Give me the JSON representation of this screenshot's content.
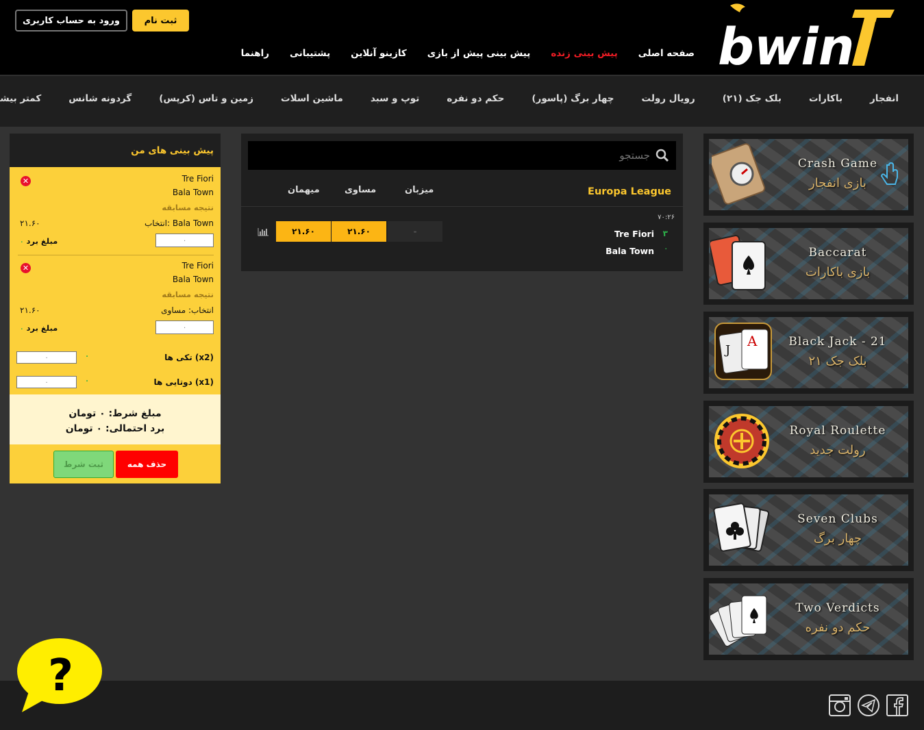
{
  "header": {
    "logo_text": "bwin",
    "login_label": "ورود به حساب کاربری",
    "register_label": "ثبت نام",
    "nav": [
      "صفحه اصلی",
      "پیش بینی زنده",
      "پیش بینی پیش از بازی",
      "کازینو آنلاین",
      "پشتیبانی",
      "راهنما"
    ],
    "active_nav": "پیش بینی زنده"
  },
  "game_nav": [
    "انفجار",
    "باکارات",
    "بلک جک (۲۱)",
    "رویال رولت",
    "چهار برگ (پاسور)",
    "حکم دو نفره",
    "توپ و سبد",
    "ماشین اسلات",
    "زمین و تاس (کرپس)",
    "گردونه شانس",
    "کمتر بیشتر"
  ],
  "banners": [
    {
      "en": "Crash Game",
      "fa": "بازی انفجار"
    },
    {
      "en": "Baccarat",
      "fa": "بازی باکارات"
    },
    {
      "en": "Black Jack - 21",
      "fa": "بلک جک ۲۱"
    },
    {
      "en": "Royal Roulette",
      "fa": "رولت جدید"
    },
    {
      "en": "Seven Clubs",
      "fa": "چهار برگ"
    },
    {
      "en": "Two Verdicts",
      "fa": "حکم دو نفره"
    }
  ],
  "center": {
    "search_placeholder": "جستجو",
    "league": "Europa League",
    "col_home": "میزبان",
    "col_draw": "مساوی",
    "col_away": "میهمان",
    "match": {
      "time": "۷۰:۲۶",
      "home": "Tre Fiori",
      "away": "Bala Town",
      "home_score": "۳",
      "away_score": "۰",
      "odds_home": "-",
      "odds_draw": "۲۱.۶۰",
      "odds_away": "۲۱.۶۰"
    }
  },
  "slip": {
    "title": "پیش بینی های من",
    "bets": [
      {
        "home": "Tre Fiori",
        "away": "Bala Town",
        "market": "نتیجه مسابقه",
        "selection": "انتخاب: Bala Town",
        "odds": "۲۱.۶۰",
        "amount_label": "مبلغ برد",
        "amount": "۰",
        "stake": "۰"
      },
      {
        "home": "Tre Fiori",
        "away": "Bala Town",
        "market": "نتیجه مسابقه",
        "selection": "انتخاب: مساوی",
        "odds": "۲۱.۶۰",
        "amount_label": "مبلغ برد",
        "amount": "۰",
        "stake": "۰"
      }
    ],
    "singles_label": "تکی ها (x2)",
    "doubles_label": "دوتایی ها (x1)",
    "singles_value": "۰",
    "doubles_value": "۰",
    "singles_stake": "۰",
    "doubles_stake": "۰",
    "total_stake": "مبلغ شرط: ۰ تومان",
    "potential_win": "برد احتمالی: ۰ تومان",
    "delete_all": "حذف همه",
    "submit": "ثبت شرط"
  },
  "colors": {
    "accent": "#fcc72e",
    "live": "#ee1c24",
    "odds": "#fcb514"
  }
}
